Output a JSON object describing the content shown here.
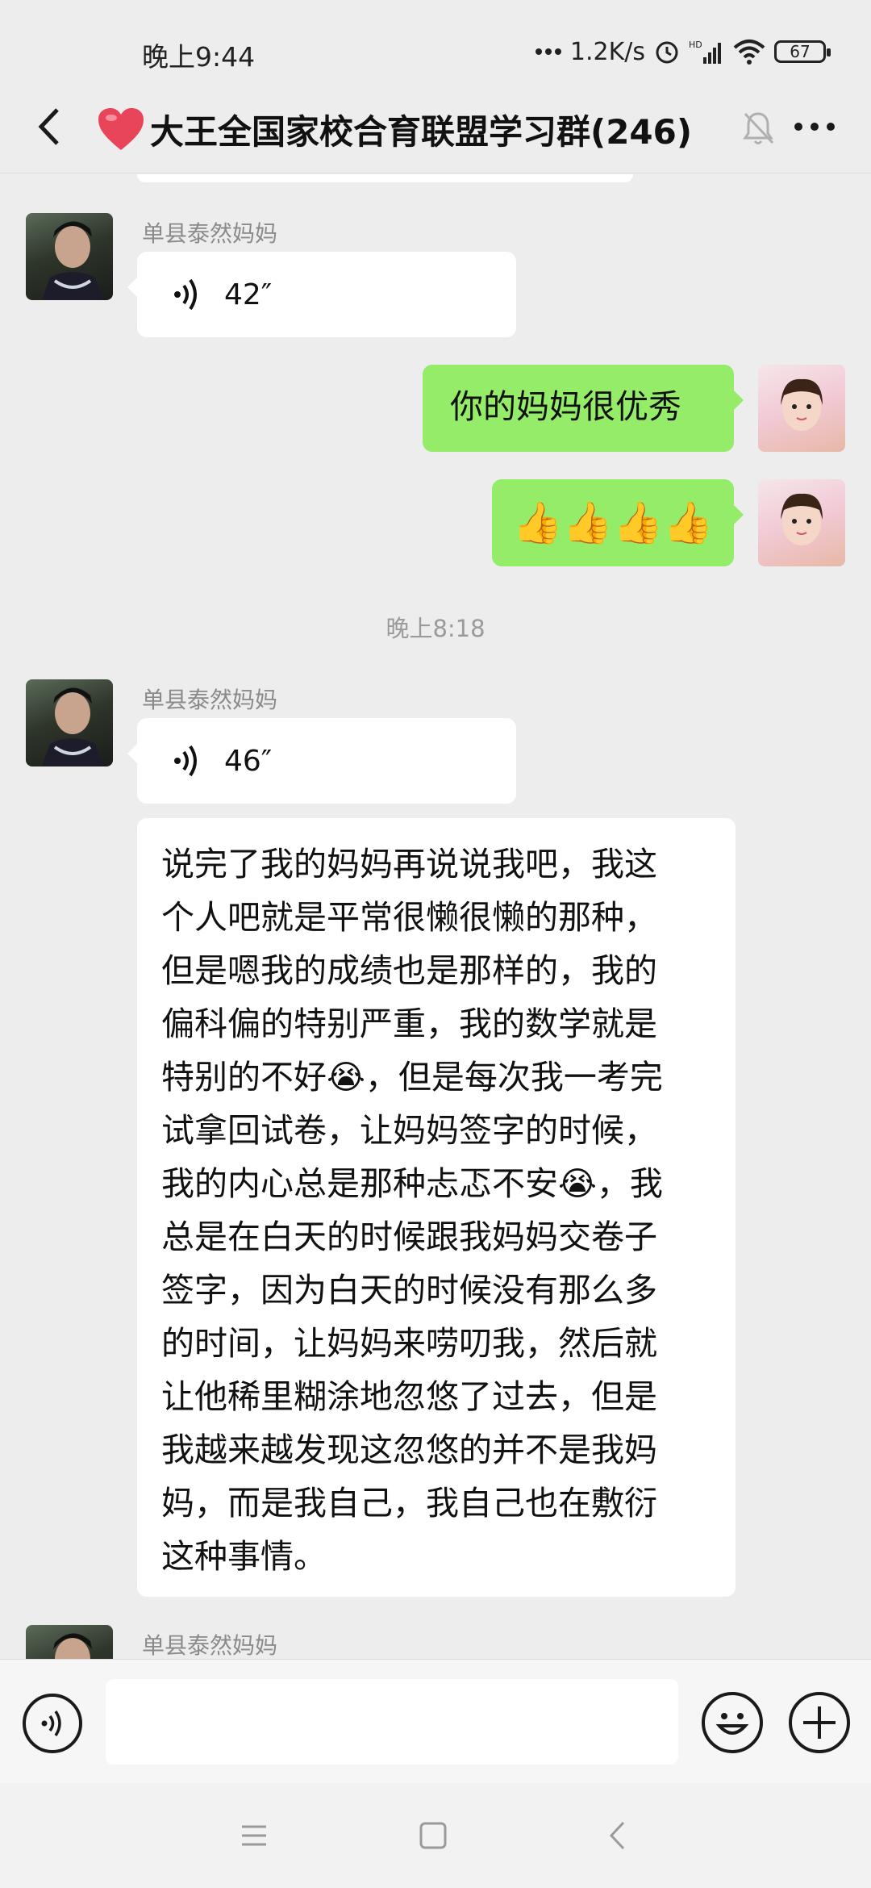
{
  "status_bar": {
    "time": "晚上9:44",
    "network_speed": "1.2K/s",
    "battery": "67",
    "icons": [
      "more-dots-icon",
      "alarm-icon",
      "hd-signal-icon",
      "wifi-icon",
      "battery-icon"
    ]
  },
  "header": {
    "title": "大王全国家校合育联盟学习群(246)",
    "heart_color": "#e8455a",
    "muted": true
  },
  "messages": [
    {
      "sender": "单县泰然妈妈",
      "type": "voice",
      "duration": "42″",
      "side": "left"
    },
    {
      "sender": "",
      "type": "text",
      "text": "你的妈妈很优秀",
      "side": "right"
    },
    {
      "sender": "",
      "type": "emoji",
      "text": "👍👍👍👍",
      "side": "right"
    },
    {
      "type": "time",
      "text": "晚上8:18"
    },
    {
      "sender": "单县泰然妈妈",
      "type": "voice",
      "duration": "46″",
      "side": "left"
    },
    {
      "sender": "",
      "type": "text",
      "side": "left",
      "lines": [
        "说完了我的妈妈再说说我吧，我这",
        "个人吧就是平常很懒很懒的那种，",
        "但是嗯我的成绩也是那样的，我的",
        "偏科偏的特别严重，我的数学就是",
        "特别的不好😭，但是每次我一考完",
        "试拿回试卷，让妈妈签字的时候，",
        "我的内心总是那种忐忑不安😭，我",
        "总是在白天的时候跟我妈妈交卷子",
        "签字，因为白天的时候没有那么多",
        "的时间，让妈妈来唠叨我，然后就",
        "让他稀里糊涂地忽悠了过去，但是",
        "我越来越发现这忽悠的并不是我妈",
        "妈，而是我自己，我自己也在敷衍",
        "这种事情。"
      ]
    },
    {
      "sender": "单县泰然妈妈",
      "type": "partial",
      "side": "left"
    }
  ],
  "input": {
    "value": "",
    "placeholder": ""
  },
  "colors": {
    "accent_green": "#95ec69",
    "background": "#ededed"
  }
}
